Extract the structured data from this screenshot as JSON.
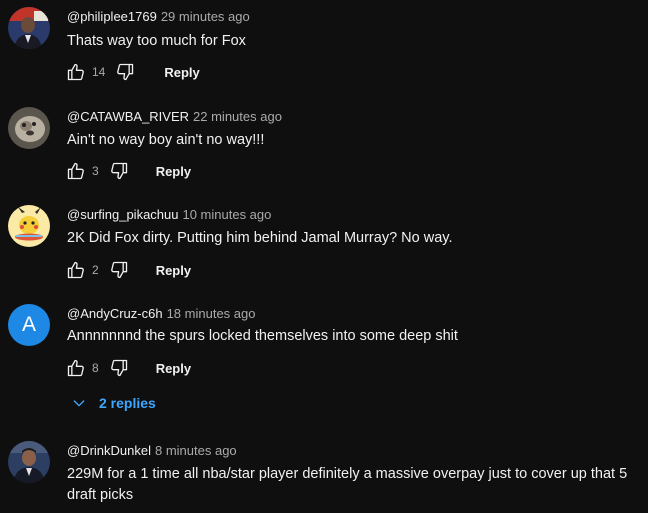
{
  "comments": [
    {
      "author": "@philiplee1769",
      "time": "29 minutes ago",
      "text": "Thats way too much for Fox",
      "likes": "14",
      "reply_label": "Reply",
      "avatar": "photo-avatar-man-in-suit"
    },
    {
      "author": "@CATAWBA_RIVER",
      "time": "22 minutes ago",
      "text": "Ain't no way boy ain't no way!!!",
      "likes": "3",
      "reply_label": "Reply",
      "avatar": "photo-avatar-animal"
    },
    {
      "author": "@surfing_pikachuu",
      "time": "10 minutes ago",
      "text": "2K Did Fox dirty. Putting him behind Jamal Murray? No way.",
      "likes": "2",
      "reply_label": "Reply",
      "avatar": "cartoon-pikachu-avatar"
    },
    {
      "author": "@AndyCruz-c6h",
      "time": "18 minutes ago",
      "text": "Annnnnnnd the spurs locked themselves into some deep shit",
      "likes": "8",
      "reply_label": "Reply",
      "avatar_letter": "A",
      "avatar_color": "#1e88e5",
      "replies_label": "2 replies"
    },
    {
      "author": "@DrinkDunkel",
      "time": "8 minutes ago",
      "text": "229M for a 1 time all nba/star player definitely a massive overpay just to cover up that 5 draft picks",
      "avatar": "photo-avatar-man-in-suit"
    }
  ],
  "colors": {
    "background": "#0f0f0f",
    "text": "#f1f1f1",
    "meta": "#aaaaaa",
    "link": "#3ea6ff"
  }
}
